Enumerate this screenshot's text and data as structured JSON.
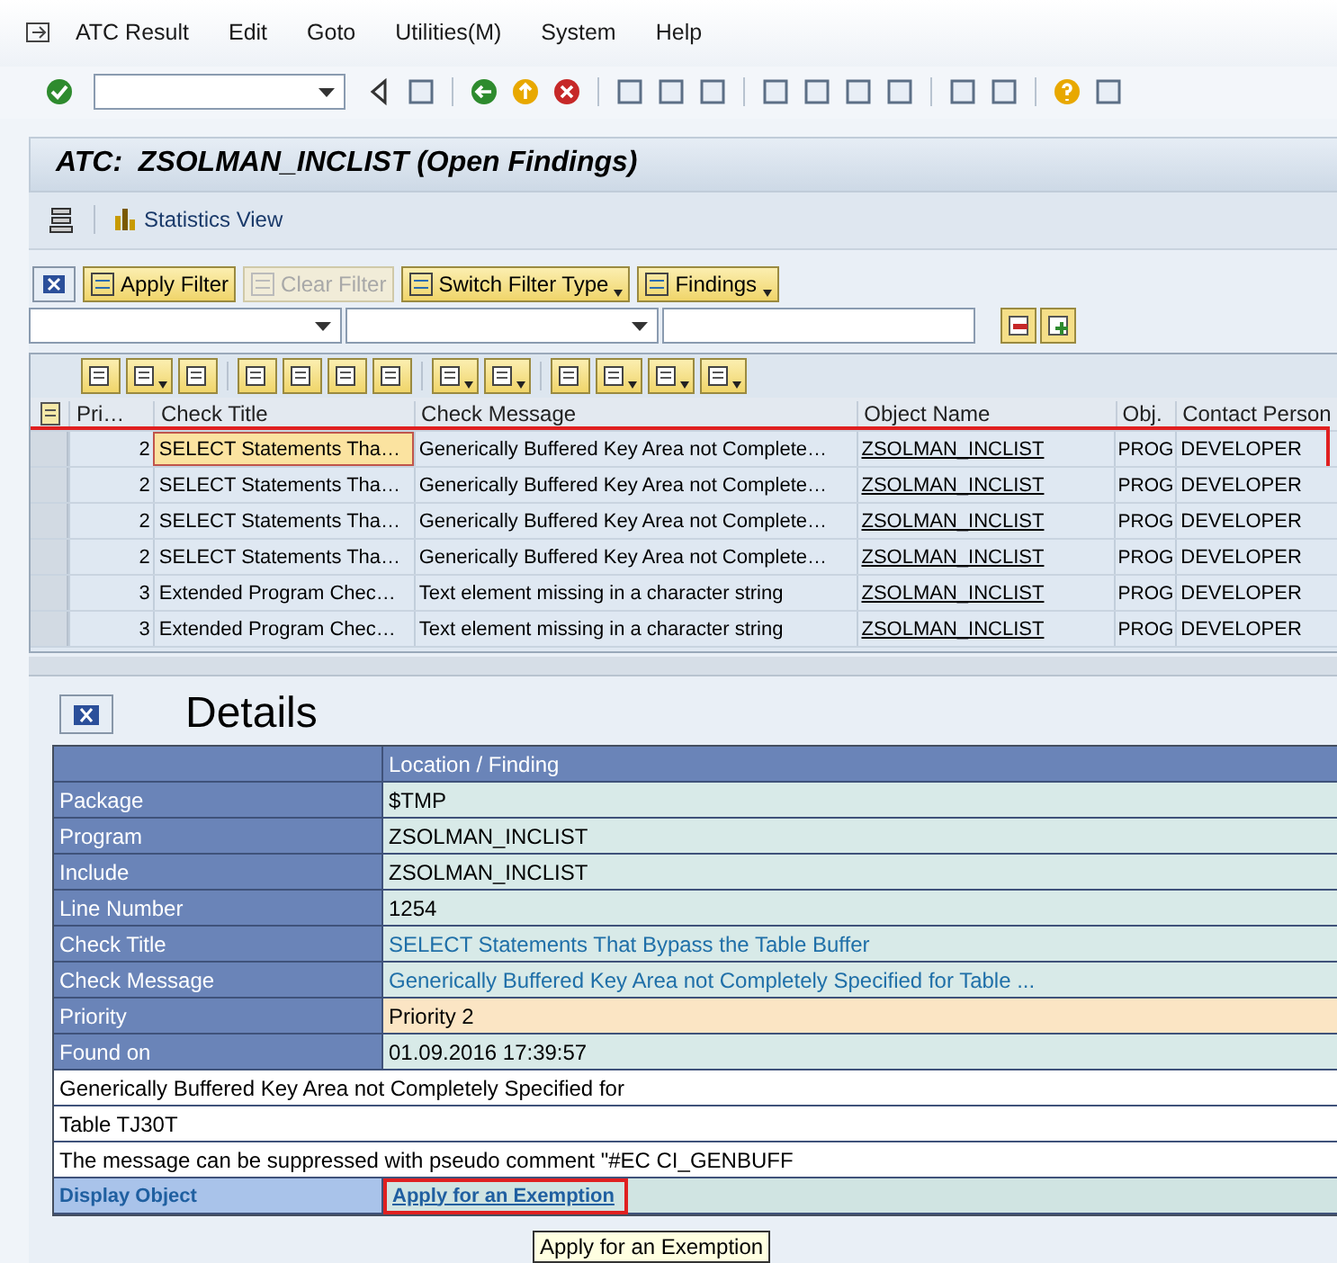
{
  "menu_bar": {
    "items": [
      "ATC Result",
      "Edit",
      "Goto",
      "Utilities(M)",
      "System",
      "Help"
    ]
  },
  "title_bar": {
    "title": "ATC:  ZSOLMAN_INCLIST (Open Findings)"
  },
  "app_toolbar": {
    "items": [
      {
        "label": "Statistics View"
      }
    ]
  },
  "filter_toolbar": {
    "buttons": [
      {
        "label": "Apply Filter",
        "disabled": false,
        "dropdown": false
      },
      {
        "label": "Clear Filter",
        "disabled": true,
        "dropdown": false
      },
      {
        "label": "Switch Filter Type",
        "disabled": false,
        "dropdown": true
      },
      {
        "label": "Findings",
        "disabled": false,
        "dropdown": true
      }
    ]
  },
  "table": {
    "columns": [
      "Pri…",
      "Check Title",
      "Check Message",
      "Object Name",
      "Obj.",
      "Contact Person"
    ],
    "rows": [
      {
        "selected": true,
        "annotated": true,
        "cells": [
          "2",
          "SELECT Statements Tha…",
          "Generically Buffered Key Area not Complete…",
          "ZSOLMAN_INCLIST",
          "PROG",
          "DEVELOPER"
        ]
      },
      {
        "selected": false,
        "annotated": false,
        "cells": [
          "2",
          "SELECT Statements Tha…",
          "Generically Buffered Key Area not Complete…",
          "ZSOLMAN_INCLIST",
          "PROG",
          "DEVELOPER"
        ]
      },
      {
        "selected": false,
        "annotated": false,
        "cells": [
          "2",
          "SELECT Statements Tha…",
          "Generically Buffered Key Area not Complete…",
          "ZSOLMAN_INCLIST",
          "PROG",
          "DEVELOPER"
        ]
      },
      {
        "selected": false,
        "annotated": false,
        "cells": [
          "2",
          "SELECT Statements Tha…",
          "Generically Buffered Key Area not Complete…",
          "ZSOLMAN_INCLIST",
          "PROG",
          "DEVELOPER"
        ]
      },
      {
        "selected": false,
        "annotated": false,
        "cells": [
          "3",
          "Extended Program Chec…",
          "Text element missing in a character string",
          "ZSOLMAN_INCLIST",
          "PROG",
          "DEVELOPER"
        ]
      },
      {
        "selected": false,
        "annotated": false,
        "cells": [
          "3",
          "Extended Program Chec…",
          "Text element missing in a character string",
          "ZSOLMAN_INCLIST",
          "PROG",
          "DEVELOPER"
        ]
      }
    ]
  },
  "details": {
    "heading": "Details",
    "column_header": "Location / Finding",
    "fields": [
      {
        "label": "Package",
        "value": "$TMP",
        "kind": "plain"
      },
      {
        "label": "Program",
        "value": "ZSOLMAN_INCLIST",
        "kind": "plain"
      },
      {
        "label": "Include",
        "value": "ZSOLMAN_INCLIST",
        "kind": "plain"
      },
      {
        "label": "Line Number",
        "value": "1254",
        "kind": "plain"
      },
      {
        "label": "Check Title",
        "value": "SELECT Statements That Bypass the Table Buffer",
        "kind": "link"
      },
      {
        "label": "Check Message",
        "value": "Generically Buffered Key Area not Completely Specified for Table ...",
        "kind": "link"
      },
      {
        "label": "Priority",
        "value": "Priority 2",
        "kind": "priority"
      },
      {
        "label": "Found on",
        "value": "01.09.2016 17:39:57",
        "kind": "plain"
      }
    ],
    "message_lines": [
      "Generically Buffered Key Area not Completely Specified for",
      "Table TJ30T",
      "The message can be suppressed with pseudo comment \"#EC CI_GENBUFF"
    ],
    "footer": {
      "display_object": "Display Object",
      "exemption_link": {
        "label": "Apply for an Exemption",
        "annotated": true
      }
    }
  },
  "tooltip": {
    "text": "Apply for an Exemption"
  }
}
